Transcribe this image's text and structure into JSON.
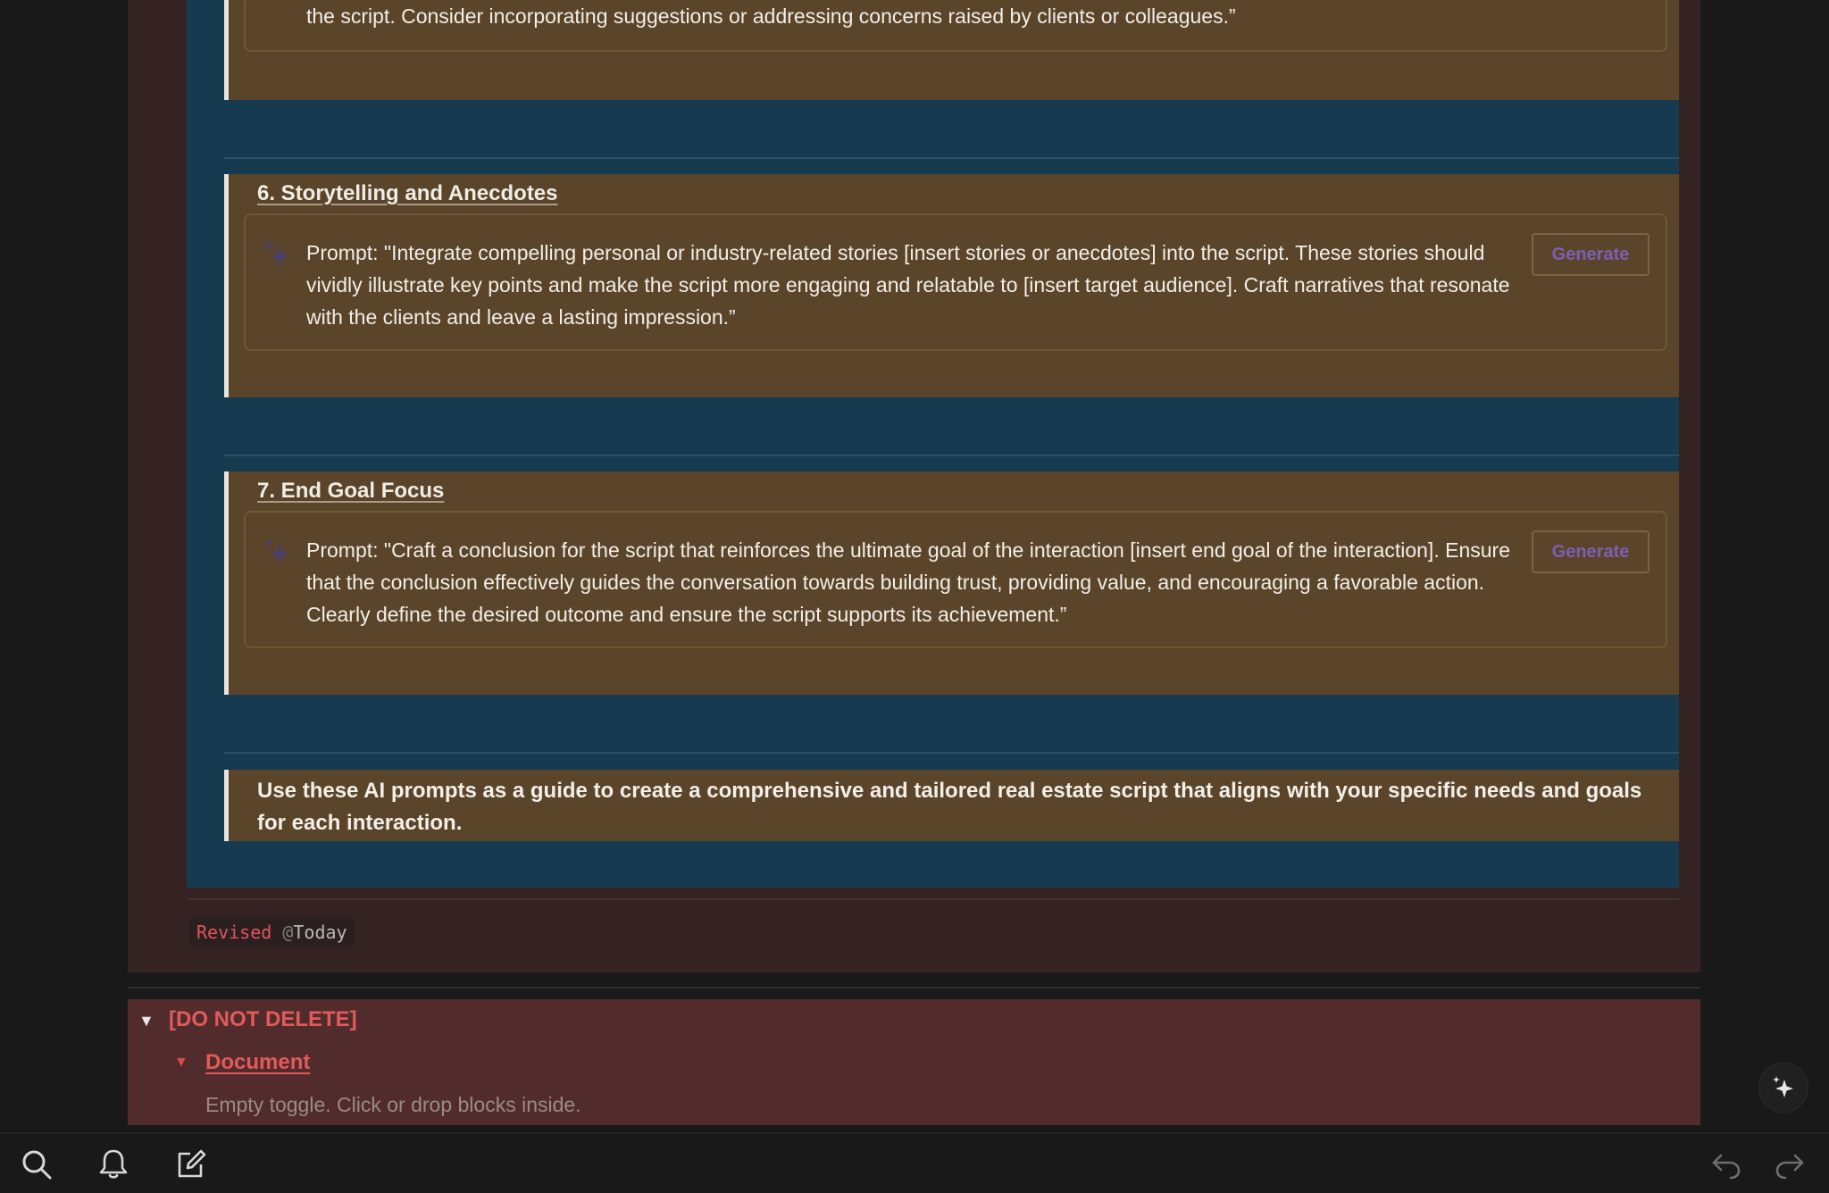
{
  "section_5": {
    "prompt_tail": "the script. Consider incorporating suggestions or addressing concerns raised by clients or colleagues.”"
  },
  "section_6": {
    "title": "6. Storytelling and Anecdotes",
    "prompt": "Prompt: \"Integrate compelling personal or industry-related stories [insert stories or anecdotes] into the script. These stories should vividly illustrate key points and make the script more engaging and relatable to [insert target audience]. Craft narratives that resonate with the clients and leave a lasting impression.”",
    "button_label": "Generate"
  },
  "section_7": {
    "title": "7. End Goal Focus",
    "prompt": "Prompt: \"Craft a conclusion for the script that reinforces the ultimate goal of the interaction [insert end goal of the interaction]. Ensure that the conclusion effectively guides the conversation towards building trust, providing value, and encouraging a favorable action. Clearly define the desired outcome and ensure the script supports its achievement.”",
    "button_label": "Generate"
  },
  "closing": {
    "text": "Use these AI prompts as a guide to create a comprehensive and tailored real estate script that aligns with your specific needs and goals for each interaction."
  },
  "revised": {
    "label": "Revised",
    "at": "@",
    "date": "Today"
  },
  "do_not_delete": {
    "title": "[DO NOT DELETE]",
    "child_title": "Document",
    "empty_hint": "Empty toggle. Click or drop blocks inside."
  },
  "icons": {
    "sparkle": "sparkle-icon",
    "search": "search-icon",
    "bell": "bell-icon",
    "compose": "compose-icon",
    "undo": "undo-icon",
    "redo": "redo-icon"
  },
  "colors": {
    "background": "#191919",
    "outer_card": "#352324",
    "inner_blue": "#163b51",
    "callout_brown": "#5b452a",
    "red_section": "#522c2c",
    "accent_red": "#e25a5a",
    "generate_purple": "#7b5fb5"
  }
}
